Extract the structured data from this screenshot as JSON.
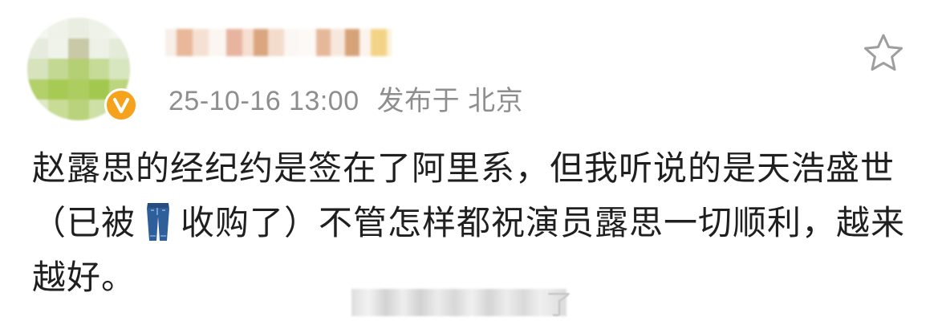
{
  "post": {
    "timestamp": "25-10-16 13:00",
    "location_prefix": "发布于",
    "location": "北京",
    "content_parts": [
      "赵露思的经纪约是签在了阿里系，但我听说的是天浩盛世（已被",
      "收购了）不管怎样都祝演员露思一切顺利，越来越好。"
    ],
    "tail_char": "了"
  },
  "icons": {
    "avatar": "avatar-blurred",
    "verified": "verified-badge-icon",
    "star": "star-icon",
    "jeans": "jeans-emoji-icon"
  },
  "colors": {
    "text": "#1f1f1f",
    "meta": "#8e8e8e",
    "verified_badge": "#f6a21d",
    "star_outline": "#9e9e9e",
    "jeans": "#2f5f9a"
  }
}
